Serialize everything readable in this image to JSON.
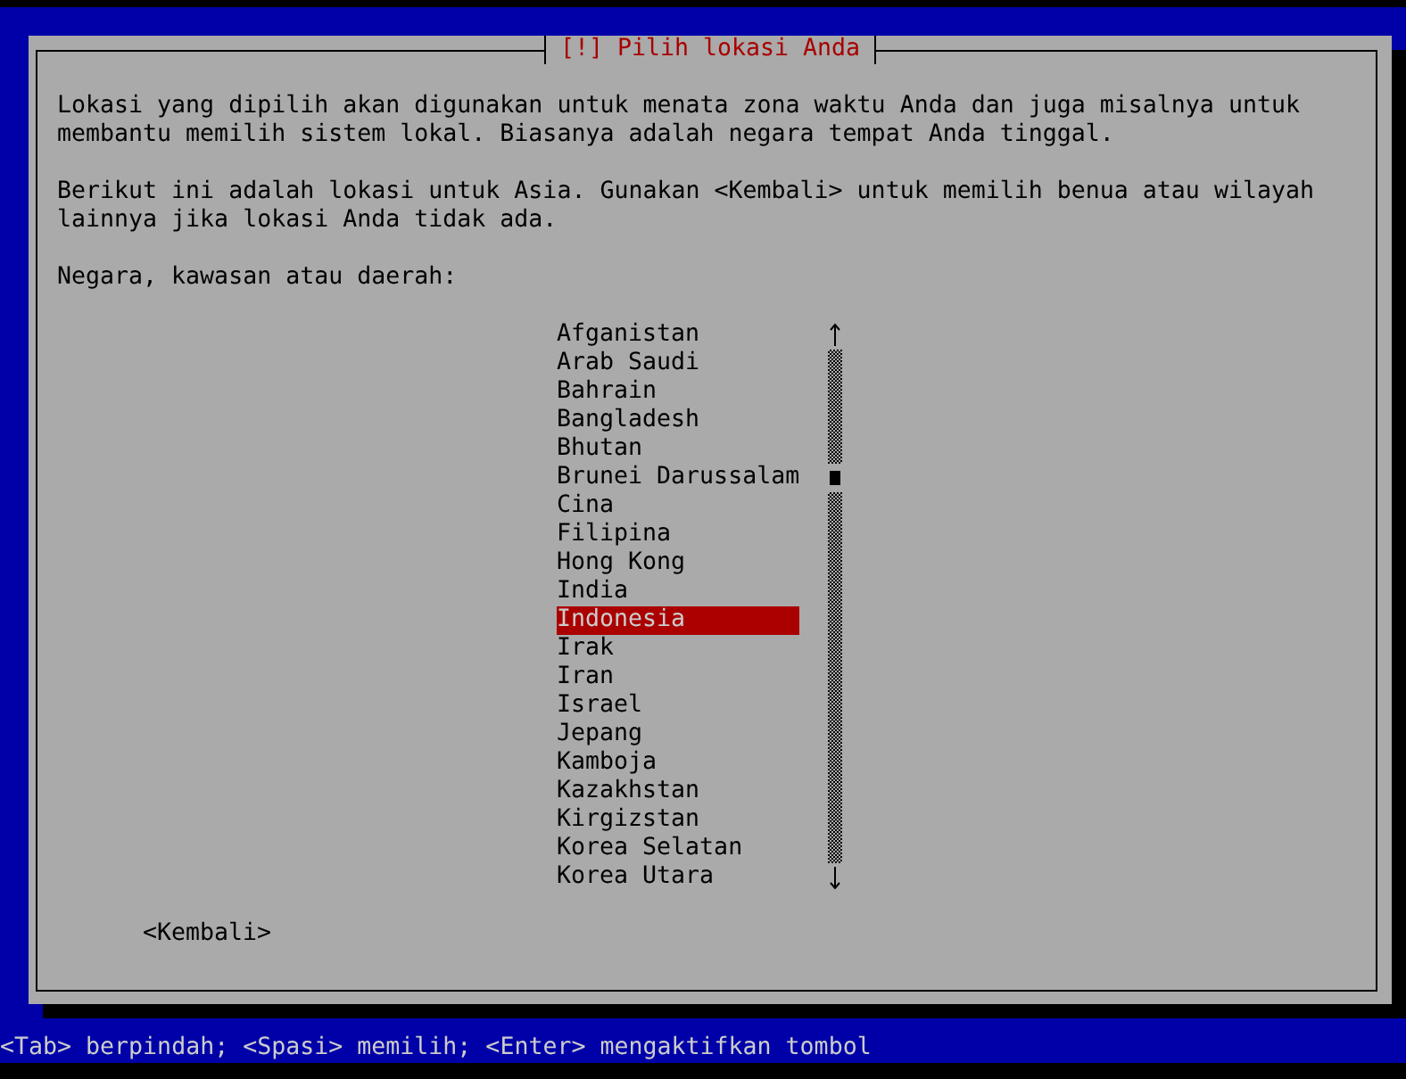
{
  "dialog": {
    "title": "[!] Pilih lokasi Anda",
    "paragraphs": [
      "Lokasi yang dipilih akan digunakan untuk menata zona waktu Anda dan juga misalnya untuk\nmembantu memilih sistem lokal. Biasanya adalah negara tempat Anda tinggal.",
      "Berikut ini adalah lokasi untuk Asia. Gunakan <Kembali> untuk memilih benua atau wilayah\nlainnya jika lokasi Anda tidak ada.",
      "Negara, kawasan atau daerah:"
    ],
    "list": [
      {
        "label": "Afganistan",
        "selected": false
      },
      {
        "label": "Arab Saudi",
        "selected": false
      },
      {
        "label": "Bahrain",
        "selected": false
      },
      {
        "label": "Bangladesh",
        "selected": false
      },
      {
        "label": "Bhutan",
        "selected": false
      },
      {
        "label": "Brunei Darussalam",
        "selected": false
      },
      {
        "label": "Cina",
        "selected": false
      },
      {
        "label": "Filipina",
        "selected": false
      },
      {
        "label": "Hong Kong",
        "selected": false
      },
      {
        "label": "India",
        "selected": false
      },
      {
        "label": "Indonesia",
        "selected": true
      },
      {
        "label": "Irak",
        "selected": false
      },
      {
        "label": "Iran",
        "selected": false
      },
      {
        "label": "Israel",
        "selected": false
      },
      {
        "label": "Jepang",
        "selected": false
      },
      {
        "label": "Kamboja",
        "selected": false
      },
      {
        "label": "Kazakhstan",
        "selected": false
      },
      {
        "label": "Kirgizstan",
        "selected": false
      },
      {
        "label": "Korea Selatan",
        "selected": false
      },
      {
        "label": "Korea Utara",
        "selected": false
      }
    ],
    "back_button": "<Kembali>"
  },
  "status_bar": "<Tab> berpindah; <Spasi> memilih; <Enter> mengaktifkan tombol"
}
